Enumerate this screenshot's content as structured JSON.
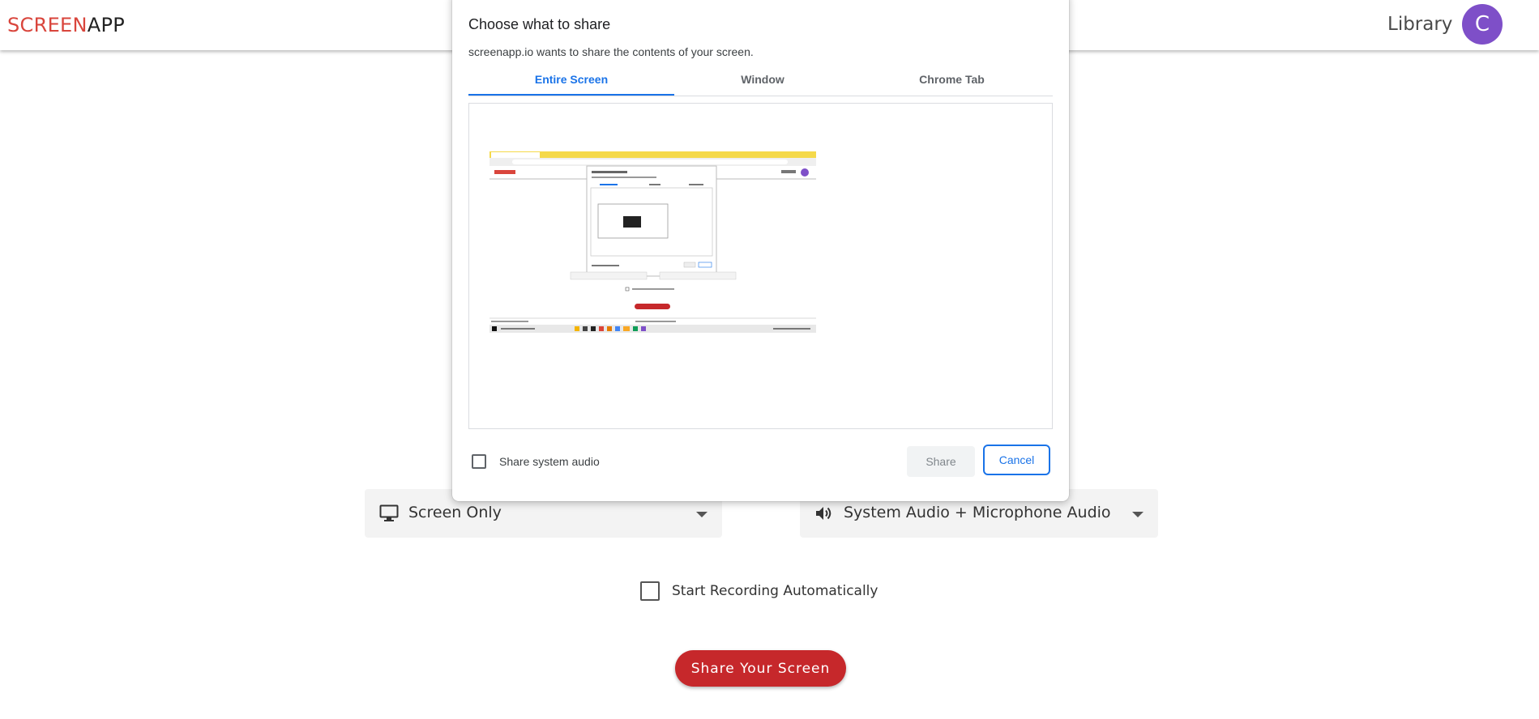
{
  "header": {
    "logo_part1": "SCREEN",
    "logo_part2": "APP",
    "library_link": "Library",
    "avatar_initial": "C"
  },
  "main": {
    "video_source_select": {
      "value": "Screen Only",
      "icon": "monitor-icon"
    },
    "audio_source_select": {
      "value": "System Audio + Microphone Audio",
      "icon": "speaker-icon"
    },
    "auto_record_label": "Start Recording Automatically",
    "auto_record_checked": false,
    "share_button": "Share Your Screen"
  },
  "share_dialog": {
    "title": "Choose what to share",
    "subtitle": "screenapp.io wants to share the contents of your screen.",
    "tabs": [
      {
        "label": "Entire Screen",
        "active": true
      },
      {
        "label": "Window",
        "active": false
      },
      {
        "label": "Chrome Tab",
        "active": false
      }
    ],
    "share_system_audio_label": "Share system audio",
    "share_system_audio_checked": false,
    "share_button": "Share",
    "cancel_button": "Cancel"
  },
  "colors": {
    "brand_red": "#d9453c",
    "avatar_purple": "#7e4fc8",
    "primary_button": "#c6282b",
    "chrome_blue": "#1a73e8"
  }
}
